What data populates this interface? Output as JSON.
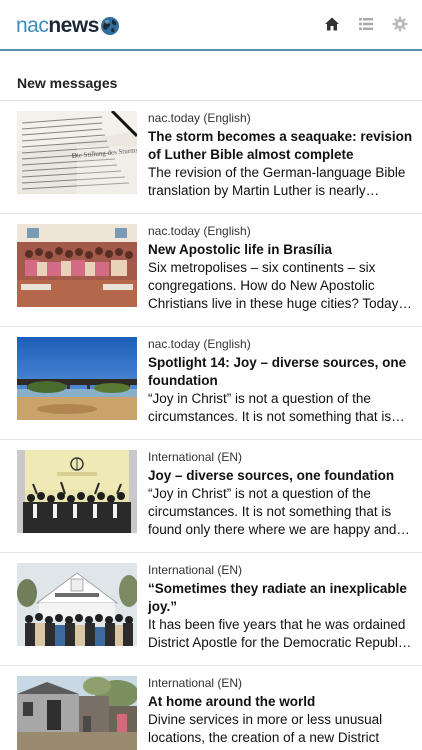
{
  "header": {
    "logo_nac": "nac",
    "logo_news": "news",
    "icons": [
      "home-icon",
      "list-icon",
      "gear-icon"
    ]
  },
  "section": {
    "title": "New messages"
  },
  "articles": [
    {
      "source": "nac.today (English)",
      "title": "The storm becomes a seaquake: revision of Luther Bible almost complete",
      "excerpt": "The revision of the German-language Bible translation by Martin Luther is nearly…"
    },
    {
      "source": "nac.today (English)",
      "title": "New Apostolic life in Brasília",
      "excerpt": "Six metropolises – six continents – six congregations. How do New Apostolic Christians live in these huge cities? Today…"
    },
    {
      "source": "nac.today (English)",
      "title": "Spotlight 14: Joy – diverse sources, one foundation",
      "excerpt": "“Joy in Christ” is not a question of the circumstances. It is not something that is…"
    },
    {
      "source": "International (EN)",
      "title": "Joy – diverse sources, one foundation",
      "excerpt": "“Joy in Christ” is not a question of the circumstances. It is not something that is found only there where we are happy and…"
    },
    {
      "source": "International (EN)",
      "title": "“Sometimes they radiate an inexplicable joy.”",
      "excerpt": "It has been five years that he was ordained District Apostle for the Democratic Republ…"
    },
    {
      "source": "International (EN)",
      "title": "At home around the world",
      "excerpt": "Divine services in more or less unusual locations, the creation of a new District"
    }
  ]
}
